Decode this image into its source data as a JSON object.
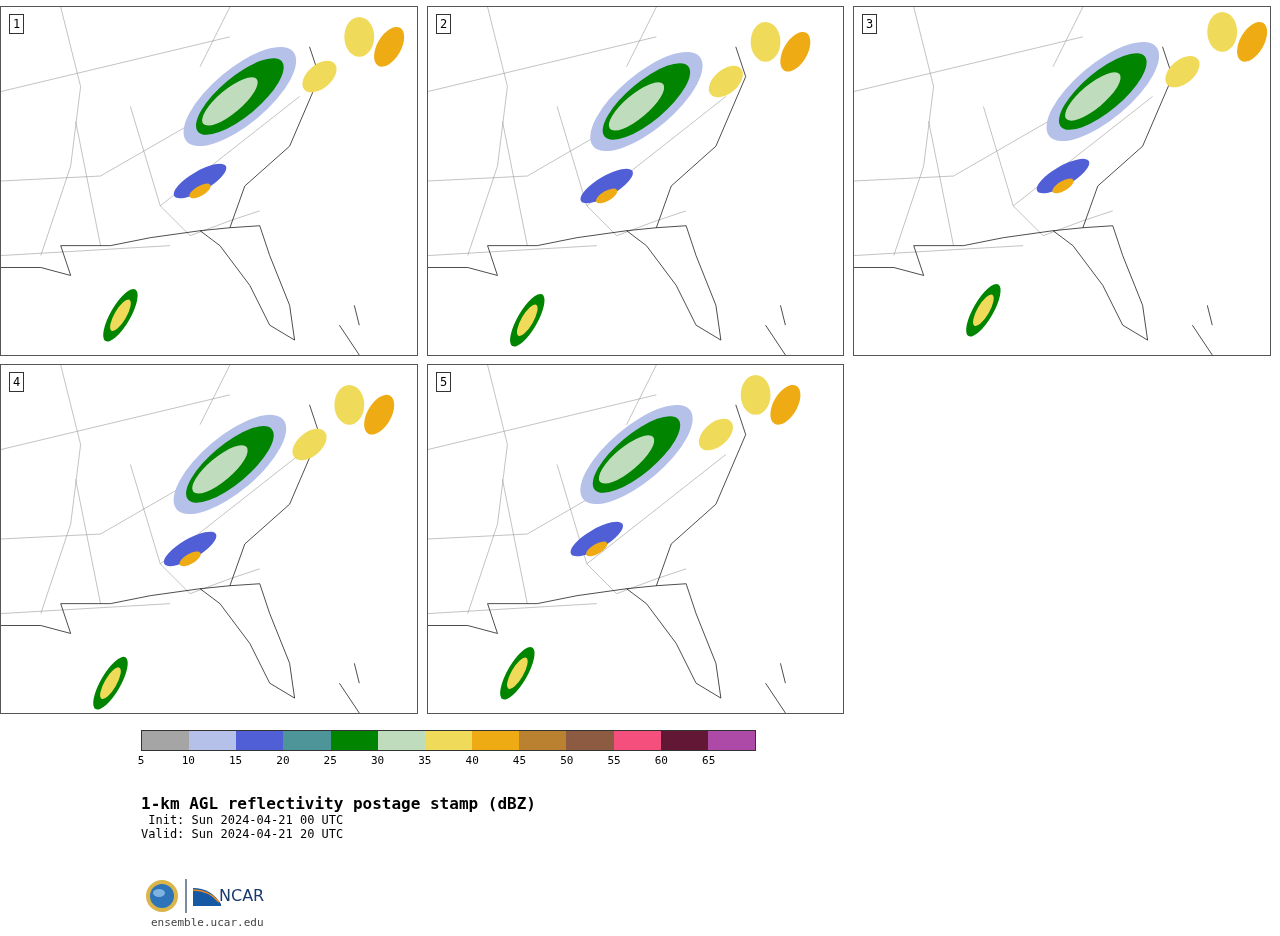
{
  "panels": [
    {
      "number": "1"
    },
    {
      "number": "2"
    },
    {
      "number": "3"
    },
    {
      "number": "4"
    },
    {
      "number": "5"
    }
  ],
  "colorbar": {
    "segments": [
      {
        "color": "#a5a5a5"
      },
      {
        "color": "#b6c1ea"
      },
      {
        "color": "#505fd6"
      },
      {
        "color": "#4d9598"
      },
      {
        "color": "#018400"
      },
      {
        "color": "#bfddbd"
      },
      {
        "color": "#f0da5a"
      },
      {
        "color": "#efab13"
      },
      {
        "color": "#b98130"
      },
      {
        "color": "#8c5b41"
      },
      {
        "color": "#f5507d"
      },
      {
        "color": "#621834"
      },
      {
        "color": "#ad4aa8"
      }
    ],
    "ticks": [
      "5",
      "10",
      "15",
      "20",
      "25",
      "30",
      "35",
      "40",
      "45",
      "50",
      "55",
      "60",
      "65"
    ]
  },
  "title": "1-km AGL reflectivity postage stamp (dBZ)",
  "init": " Init: Sun 2024-04-21 00 UTC",
  "valid": "Valid: Sun 2024-04-21 20 UTC",
  "logo": {
    "ncar": "NCAR"
  },
  "url": "ensemble.ucar.edu"
}
